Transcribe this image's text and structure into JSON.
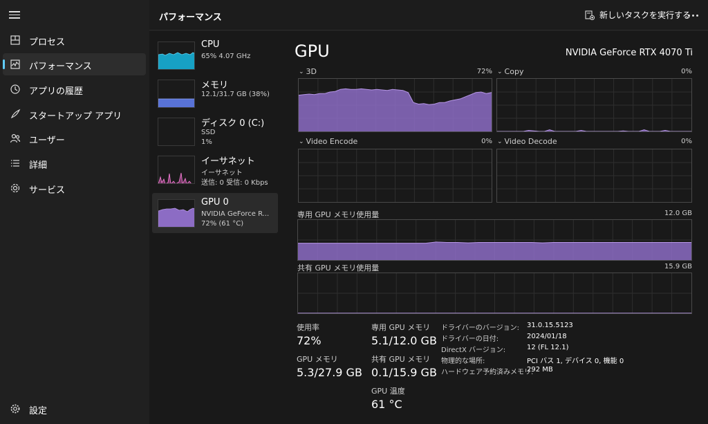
{
  "app": {
    "page_title": "パフォーマンス",
    "run_task_label": "新しいタスクを実行する"
  },
  "nav": {
    "items": [
      {
        "label": "プロセス",
        "icon": "processes-icon"
      },
      {
        "label": "パフォーマンス",
        "icon": "performance-icon",
        "active": true
      },
      {
        "label": "アプリの履歴",
        "icon": "history-icon"
      },
      {
        "label": "スタートアップ アプリ",
        "icon": "startup-icon"
      },
      {
        "label": "ユーザー",
        "icon": "users-icon"
      },
      {
        "label": "詳細",
        "icon": "details-icon"
      },
      {
        "label": "サービス",
        "icon": "services-icon"
      }
    ],
    "settings_label": "設定"
  },
  "devices": [
    {
      "name": "CPU",
      "line1": "65%  4.07 GHz",
      "line2": "",
      "color": "#17a1c4"
    },
    {
      "name": "メモリ",
      "line1": "12.1/31.7 GB (38%)",
      "line2": "",
      "color": "#5872d6"
    },
    {
      "name": "ディスク 0 (C:)",
      "line1": "SSD",
      "line2": "1%",
      "color": "#3aa955"
    },
    {
      "name": "イーサネット",
      "line1": "イーサネット",
      "line2": "送信: 0 受信: 0 Kbps",
      "color": "#d656b4"
    },
    {
      "name": "GPU 0",
      "line1": "NVIDIA GeForce R...",
      "line2": "72% (61 °C)",
      "color": "#8c6cc4",
      "active": true
    }
  ],
  "gpu": {
    "title": "GPU",
    "model": "NVIDIA GeForce RTX 4070 Ti",
    "accent": "#8c6cc4",
    "graphs": {
      "3d": {
        "label": "3D",
        "max": "72%"
      },
      "copy": {
        "label": "Copy",
        "max": "0%"
      },
      "video_encode": {
        "label": "Video Encode",
        "max": "0%"
      },
      "video_decode": {
        "label": "Video Decode",
        "max": "0%"
      },
      "dedicated_mem": {
        "label": "専用 GPU メモリ使用量",
        "max": "12.0 GB"
      },
      "shared_mem": {
        "label": "共有 GPU メモリ使用量",
        "max": "15.9 GB"
      }
    },
    "stats": {
      "utilization_label": "使用率",
      "utilization": "72%",
      "gpu_mem_label": "GPU メモリ",
      "gpu_mem": "5.3/27.9 GB",
      "dedicated_label": "専用 GPU メモリ",
      "dedicated": "5.1/12.0 GB",
      "shared_label": "共有 GPU メモリ",
      "shared": "0.1/15.9 GB",
      "temp_label": "GPU 温度",
      "temp": "61 °C"
    },
    "properties": [
      {
        "key": "ドライバーのバージョン:",
        "value": "31.0.15.5123"
      },
      {
        "key": "ドライバーの日付:",
        "value": "2024/01/18"
      },
      {
        "key": "DirectX バージョン:",
        "value": "12 (FL 12.1)"
      },
      {
        "key": "物理的な場所:",
        "value": "PCI バス 1, デバイス 0, 機能 0"
      },
      {
        "key": "ハードウェア予約済みメモリ:",
        "value": "292 MB"
      }
    ],
    "series": {
      "3d": [
        0.69,
        0.7,
        0.71,
        0.7,
        0.72,
        0.72,
        0.75,
        0.76,
        0.8,
        0.81,
        0.8,
        0.8,
        0.81,
        0.8,
        0.79,
        0.8,
        0.79,
        0.78,
        0.8,
        0.79,
        0.78,
        0.74,
        0.55,
        0.52,
        0.53,
        0.51,
        0.52,
        0.55,
        0.55,
        0.58,
        0.6,
        0.62,
        0.66,
        0.7,
        0.74,
        0.75,
        0.72,
        0.74
      ],
      "copy": [
        0,
        0,
        0,
        0,
        0,
        0,
        0.02,
        0.01,
        0,
        0,
        0.03,
        0,
        0,
        0,
        0,
        0,
        0.02,
        0,
        0,
        0,
        0,
        0,
        0,
        0,
        0.01,
        0,
        0,
        0,
        0.03,
        0,
        0,
        0,
        0.02,
        0,
        0,
        0,
        0,
        0
      ],
      "dedicated_mem": [
        0.42,
        0.42,
        0.42,
        0.42,
        0.42,
        0.42,
        0.42,
        0.42,
        0.42,
        0.42,
        0.42,
        0.42,
        0.42,
        0.45,
        0.44,
        0.44,
        0.43,
        0.44,
        0.44,
        0.44,
        0.44,
        0.44,
        0.44,
        0.43,
        0.44,
        0.44,
        0.44,
        0.44,
        0.44,
        0.44,
        0.44,
        0.44,
        0.44,
        0.44,
        0.44,
        0.44,
        0.44,
        0.44
      ],
      "shared_mem": [
        0.006,
        0.006,
        0.006,
        0.006,
        0.006,
        0.006,
        0.006,
        0.006,
        0.006,
        0.006,
        0.006,
        0.006,
        0.006,
        0.006,
        0.006,
        0.006,
        0.006,
        0.006,
        0.006,
        0.006
      ]
    }
  }
}
